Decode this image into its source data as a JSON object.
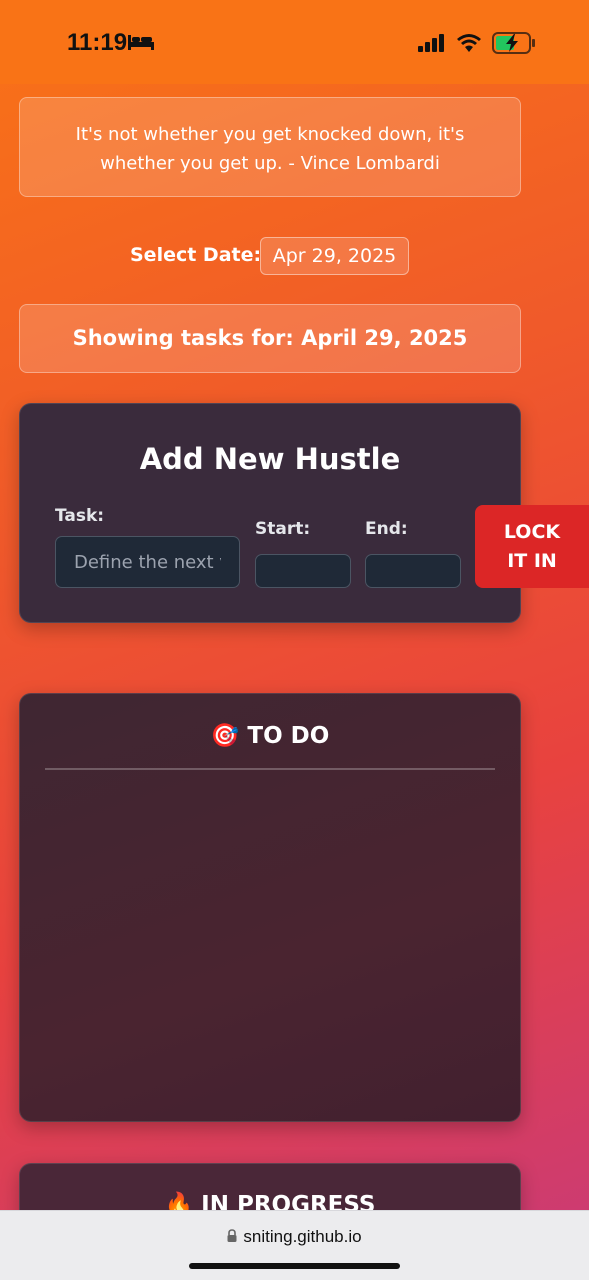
{
  "status_bar": {
    "time": "11:19"
  },
  "quote": {
    "text": "It's not whether you get knocked down, it's whether you get up. - Vince Lombardi"
  },
  "date_picker": {
    "label": "Select Date:",
    "value": "Apr 29, 2025"
  },
  "showing_banner": {
    "text": "Showing tasks for: April 29, 2025"
  },
  "add_form": {
    "title": "Add New Hustle",
    "task_label": "Task:",
    "task_placeholder": "Define the next vi",
    "start_label": "Start:",
    "end_label": "End:",
    "submit_line1": "LOCK",
    "submit_line2": "IT IN"
  },
  "columns": {
    "todo": {
      "emoji": "🎯",
      "title": "TO DO"
    },
    "in_progress": {
      "emoji": "🔥",
      "title": "IN PROGRESS"
    }
  },
  "browser": {
    "url": "sniting.github.io"
  },
  "colors": {
    "accent_orange": "#f97316",
    "danger_red": "#dc2626",
    "card_dark": "#3a2b3c"
  }
}
